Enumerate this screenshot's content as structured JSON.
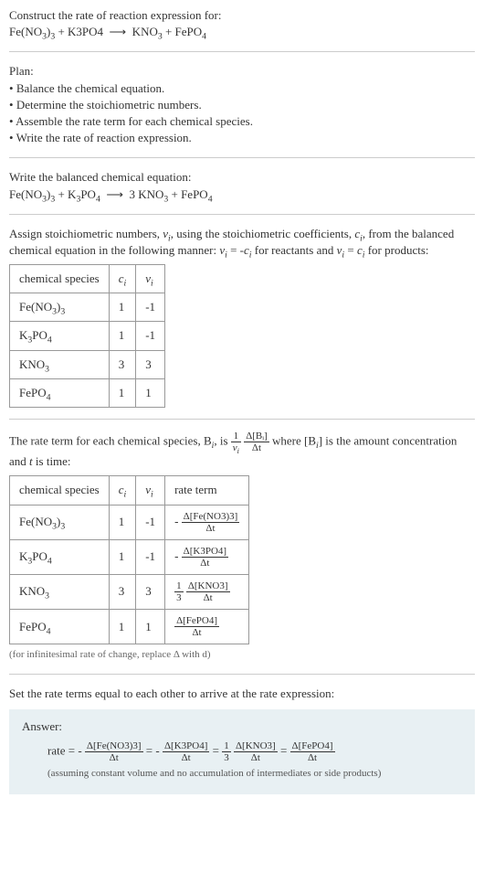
{
  "prompt": {
    "title": "Construct the rate of reaction expression for:",
    "equation_lhs1": "Fe(NO",
    "equation_lhs1_sub1": "3",
    "equation_lhs1_close": ")",
    "equation_lhs1_sub2": "3",
    "plus1": " + K3PO4  ⟶  KNO",
    "plus1_sub": "3",
    "plus2": " + FePO",
    "plus2_sub": "4"
  },
  "plan": {
    "heading": "Plan:",
    "items": [
      "Balance the chemical equation.",
      "Determine the stoichiometric numbers.",
      "Assemble the rate term for each chemical species.",
      "Write the rate of reaction expression."
    ]
  },
  "balanced": {
    "heading": "Write the balanced chemical equation:",
    "eq_text_prefix": "Fe(NO",
    "eq_text_mid": " + K",
    "po4": "PO",
    "arrow": "⟶",
    "kno": " 3 KNO",
    "fepo": " + FePO"
  },
  "assign": {
    "text1": "Assign stoichiometric numbers, ",
    "nu": "ν",
    "text2": ", using the stoichiometric coefficients, ",
    "c": "c",
    "text3": ", from the balanced chemical equation in the following manner: ",
    "rel1a": " = -",
    "rel1b": " for reactants and ",
    "rel2a": " = ",
    "rel2b": " for products:"
  },
  "table1": {
    "headers": [
      "chemical species",
      "cᵢ",
      "νᵢ"
    ],
    "rows": [
      {
        "species": "Fe(NO₃)₃",
        "c": "1",
        "nu": "-1"
      },
      {
        "species": "K₃PO₄",
        "c": "1",
        "nu": "-1"
      },
      {
        "species": "KNO₃",
        "c": "3",
        "nu": "3"
      },
      {
        "species": "FePO₄",
        "c": "1",
        "nu": "1"
      }
    ]
  },
  "rateterm": {
    "text1": "The rate term for each chemical species, B",
    "text2": ", is ",
    "frac1_num": "1",
    "frac1_den": "νᵢ",
    "frac2_num": "Δ[Bᵢ]",
    "frac2_den": "Δt",
    "text3": " where [B",
    "text4": "] is the amount concentration and ",
    "t": "t",
    "text5": " is time:"
  },
  "table2": {
    "headers": [
      "chemical species",
      "cᵢ",
      "νᵢ",
      "rate term"
    ],
    "rows": [
      {
        "species": "Fe(NO₃)₃",
        "c": "1",
        "nu": "-1",
        "sign": "-",
        "coef": "",
        "num": "Δ[Fe(NO3)3]",
        "den": "Δt"
      },
      {
        "species": "K₃PO₄",
        "c": "1",
        "nu": "-1",
        "sign": "-",
        "coef": "",
        "num": "Δ[K3PO4]",
        "den": "Δt"
      },
      {
        "species": "KNO₃",
        "c": "3",
        "nu": "3",
        "sign": "",
        "coef_num": "1",
        "coef_den": "3",
        "num": "Δ[KNO3]",
        "den": "Δt"
      },
      {
        "species": "FePO₄",
        "c": "1",
        "nu": "1",
        "sign": "",
        "coef": "",
        "num": "Δ[FePO4]",
        "den": "Δt"
      }
    ],
    "note": "(for infinitesimal rate of change, replace Δ with d)"
  },
  "set_equal": "Set the rate terms equal to each other to arrive at the rate expression:",
  "answer": {
    "label": "Answer:",
    "rate_word": "rate = ",
    "t1_sign": "-",
    "t1_num": "Δ[Fe(NO3)3]",
    "t1_den": "Δt",
    "eq": " = ",
    "t2_sign": "-",
    "t2_num": "Δ[K3PO4]",
    "t2_den": "Δt",
    "t3_coef_num": "1",
    "t3_coef_den": "3",
    "t3_num": "Δ[KNO3]",
    "t3_den": "Δt",
    "t4_num": "Δ[FePO4]",
    "t4_den": "Δt",
    "assume": "(assuming constant volume and no accumulation of intermediates or side products)"
  },
  "chart_data": {
    "type": "table",
    "tables": [
      {
        "title": "Stoichiometric numbers",
        "columns": [
          "chemical species",
          "c_i",
          "nu_i"
        ],
        "rows": [
          [
            "Fe(NO3)3",
            1,
            -1
          ],
          [
            "K3PO4",
            1,
            -1
          ],
          [
            "KNO3",
            3,
            3
          ],
          [
            "FePO4",
            1,
            1
          ]
        ]
      },
      {
        "title": "Rate terms",
        "columns": [
          "chemical species",
          "c_i",
          "nu_i",
          "rate term"
        ],
        "rows": [
          [
            "Fe(NO3)3",
            1,
            -1,
            "-Δ[Fe(NO3)3]/Δt"
          ],
          [
            "K3PO4",
            1,
            -1,
            "-Δ[K3PO4]/Δt"
          ],
          [
            "KNO3",
            3,
            3,
            "(1/3)Δ[KNO3]/Δt"
          ],
          [
            "FePO4",
            1,
            1,
            "Δ[FePO4]/Δt"
          ]
        ]
      }
    ]
  }
}
